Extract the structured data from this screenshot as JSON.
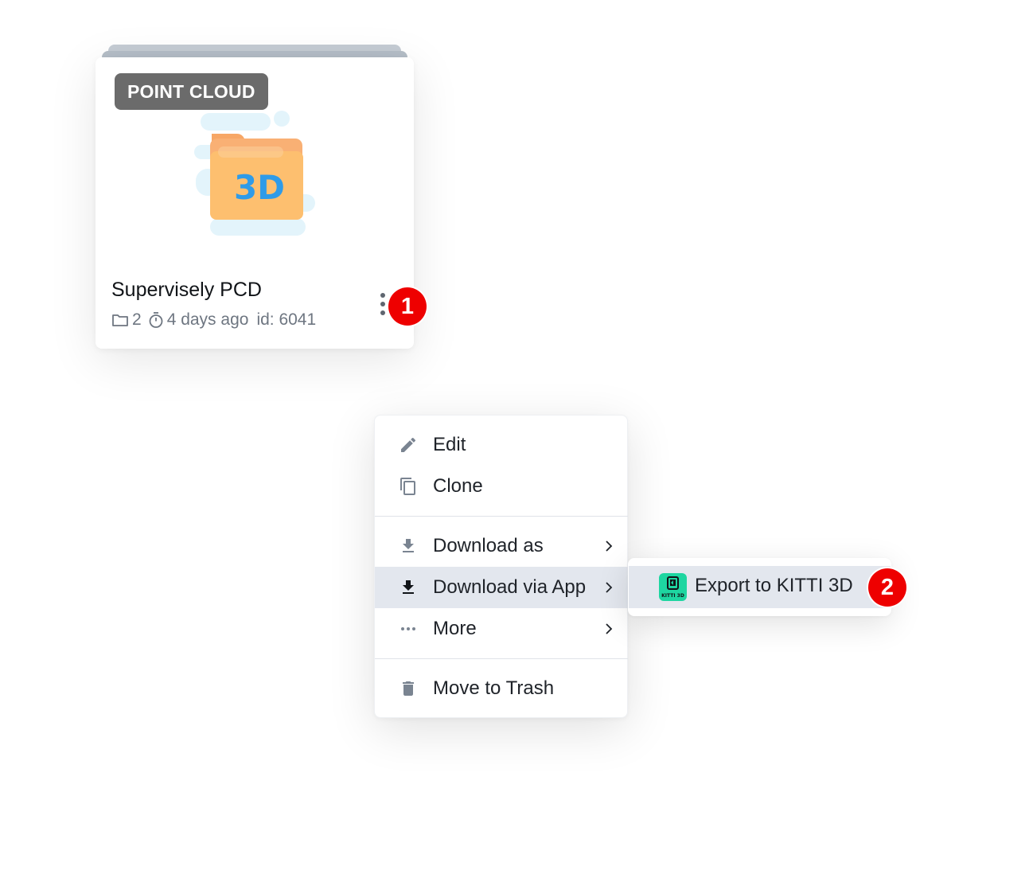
{
  "project_card": {
    "type_badge": "POINT CLOUD",
    "thumbnail_text": "3D",
    "title": "Supervisely PCD",
    "datasets_count": "2",
    "updated": "4 days ago",
    "id_text": "id: 6041"
  },
  "callouts": {
    "first": "1",
    "second": "2"
  },
  "context_menu": {
    "edit_label": "Edit",
    "clone_label": "Clone",
    "download_as_label": "Download as",
    "download_via_app_label": "Download via App",
    "more_label": "More",
    "trash_label": "Move to Trash"
  },
  "submenu": {
    "export_label": "Export to KITTI 3D",
    "app_icon_text": "KITTI 3D"
  },
  "colors": {
    "badge_bg": "#6b6b6b",
    "callout_red": "#ee0000",
    "active_item_bg": "#e3e7ee",
    "app_icon_green": "#1ed6a1",
    "folder_orange": "#fdbf6f"
  }
}
